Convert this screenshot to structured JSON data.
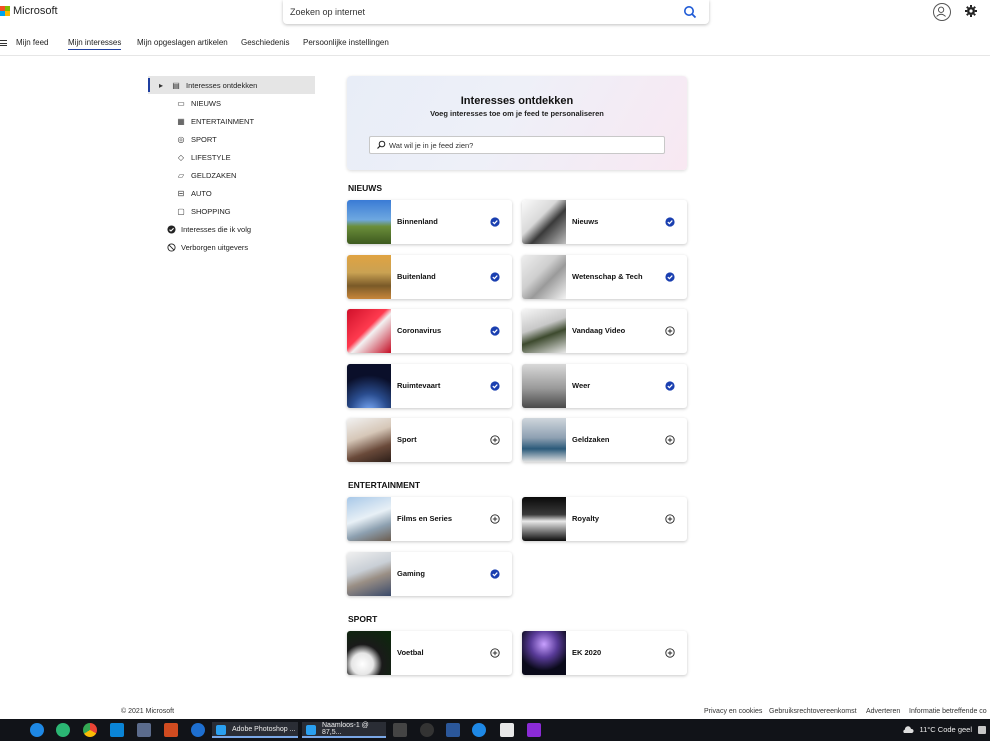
{
  "header": {
    "brand": "Microsoft",
    "search_placeholder": "Zoeken op internet",
    "logo_colors": [
      "#f25022",
      "#7fba00",
      "#00a4ef",
      "#ffb900"
    ]
  },
  "nav": {
    "items": [
      "Mijn feed",
      "Mijn interesses",
      "Mijn opgeslagen artikelen",
      "Geschiedenis",
      "Persoonlijke instellingen"
    ],
    "active": "Mijn interesses"
  },
  "sidebar": {
    "discover": "Interesses ontdekken",
    "categories": [
      "NIEUWS",
      "ENTERTAINMENT",
      "SPORT",
      "LIFESTYLE",
      "GELDZAKEN",
      "AUTO",
      "SHOPPING"
    ],
    "following": "Interesses die ik volg",
    "hidden": "Verborgen uitgevers"
  },
  "hero": {
    "title": "Interesses ontdekken",
    "subtitle": "Voeg interesses toe om je feed te personaliseren",
    "placeholder": "Wat wil je in je feed zien?"
  },
  "sections": [
    {
      "title": "NIEUWS",
      "cards": [
        {
          "label": "Binnenland",
          "followed": true
        },
        {
          "label": "Nieuws",
          "followed": true
        },
        {
          "label": "Buitenland",
          "followed": true
        },
        {
          "label": "Wetenschap & Tech",
          "followed": true
        },
        {
          "label": "Coronavirus",
          "followed": true
        },
        {
          "label": "Vandaag Video",
          "followed": false
        },
        {
          "label": "Ruimtevaart",
          "followed": true
        },
        {
          "label": "Weer",
          "followed": true
        },
        {
          "label": "Sport",
          "followed": false
        },
        {
          "label": "Geldzaken",
          "followed": false
        }
      ]
    },
    {
      "title": "ENTERTAINMENT",
      "cards": [
        {
          "label": "Films en Series",
          "followed": false
        },
        {
          "label": "Royalty",
          "followed": false
        },
        {
          "label": "Gaming",
          "followed": true
        }
      ]
    },
    {
      "title": "SPORT",
      "cards": [
        {
          "label": "Voetbal",
          "followed": false
        },
        {
          "label": "EK 2020",
          "followed": false
        }
      ]
    }
  ],
  "footer": {
    "copyright": "© 2021 Microsoft",
    "links": [
      "Privacy en cookies",
      "Gebruiksrechtovereenkomst",
      "Adverteren",
      "Informatie betreffende co"
    ]
  },
  "taskbar": {
    "apps": [
      "Adobe Photoshop ...",
      "Naamloos-1 @ 87,5..."
    ],
    "weather": "11°C  Code geel"
  },
  "colors": {
    "accent": "#1f3fa0",
    "check": "#1a3fb0"
  }
}
